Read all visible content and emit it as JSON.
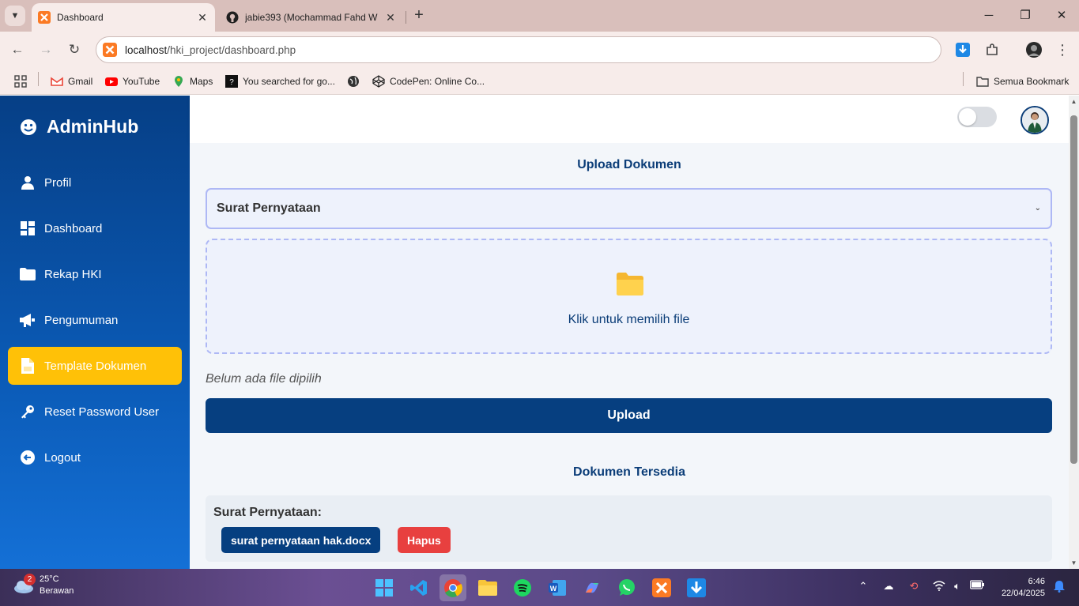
{
  "browser": {
    "tabs": [
      {
        "title": "Dashboard",
        "active": true
      },
      {
        "title": "jabie393 (Mochammad Fahd W",
        "active": false
      }
    ],
    "window_controls": {
      "minimize": "─",
      "maximize": "❐",
      "close": "✕"
    },
    "address_bar": {
      "host": "localhost",
      "path": "/hki_project/dashboard.php"
    },
    "bookmarks": [
      {
        "label": "Gmail",
        "icon": "gmail-icon"
      },
      {
        "label": "YouTube",
        "icon": "youtube-icon"
      },
      {
        "label": "Maps",
        "icon": "maps-icon"
      },
      {
        "label": "You searched for go...",
        "icon": "search-result-icon"
      },
      {
        "label": "",
        "icon": "globe-icon"
      },
      {
        "label": "CodePen: Online Co...",
        "icon": "codepen-icon"
      }
    ],
    "all_bookmarks_label": "Semua Bookmark"
  },
  "sidebar": {
    "brand": "AdminHub",
    "items": [
      {
        "label": "Profil",
        "icon": "user-icon",
        "active": false
      },
      {
        "label": "Dashboard",
        "icon": "dashboard-icon",
        "active": false
      },
      {
        "label": "Rekap HKI",
        "icon": "folder-icon",
        "active": false
      },
      {
        "label": "Pengumuman",
        "icon": "megaphone-icon",
        "active": false
      },
      {
        "label": "Template Dokumen",
        "icon": "document-icon",
        "active": true
      },
      {
        "label": "Reset Password User",
        "icon": "key-icon",
        "active": false
      },
      {
        "label": "Logout",
        "icon": "logout-icon",
        "active": false
      }
    ]
  },
  "main": {
    "upload_title": "Upload Dokumen",
    "select_value": "Surat Pernyataan",
    "dropzone_text": "Klik untuk memilih file",
    "no_file_text": "Belum ada file dipilih",
    "upload_button": "Upload",
    "available_title": "Dokumen Tersedia",
    "documents": [
      {
        "category": "Surat Pernyataan:",
        "file": "surat pernyataan hak.docx",
        "delete_label": "Hapus"
      }
    ]
  },
  "taskbar": {
    "weather": {
      "temp": "25°C",
      "condition": "Berawan",
      "badge": "2"
    },
    "time": "6:46",
    "date": "22/04/2025"
  },
  "colors": {
    "sidebar_top": "#063f86",
    "sidebar_bottom": "#1470d6",
    "active_item": "#ffc107",
    "primary": "#063f80",
    "danger": "#e8403f",
    "dropzone_border": "#aeb8f5"
  }
}
